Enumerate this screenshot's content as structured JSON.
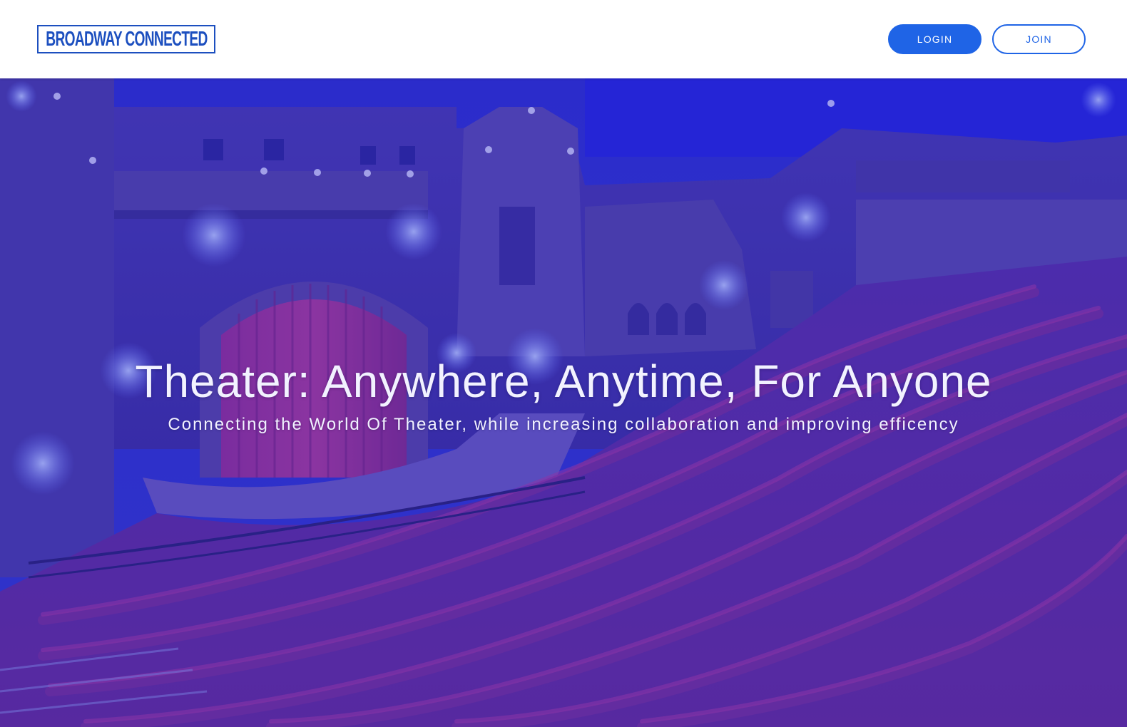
{
  "header": {
    "logo_text": "BROADWAY CONNECTED",
    "login_label": "LOGIN",
    "join_label": "JOIN"
  },
  "hero": {
    "title": "Theater: Anywhere, Anytime, For Anyone",
    "subtitle": "Connecting the World Of Theater, while increasing collaboration and improving efficency",
    "background_image": "theater-auditorium-image"
  },
  "colors": {
    "brand_blue": "#1f64e6",
    "logo_blue": "#1c4fbf",
    "hero_tint": "#2a2ad2",
    "seat_red": "#8a2a6e"
  }
}
